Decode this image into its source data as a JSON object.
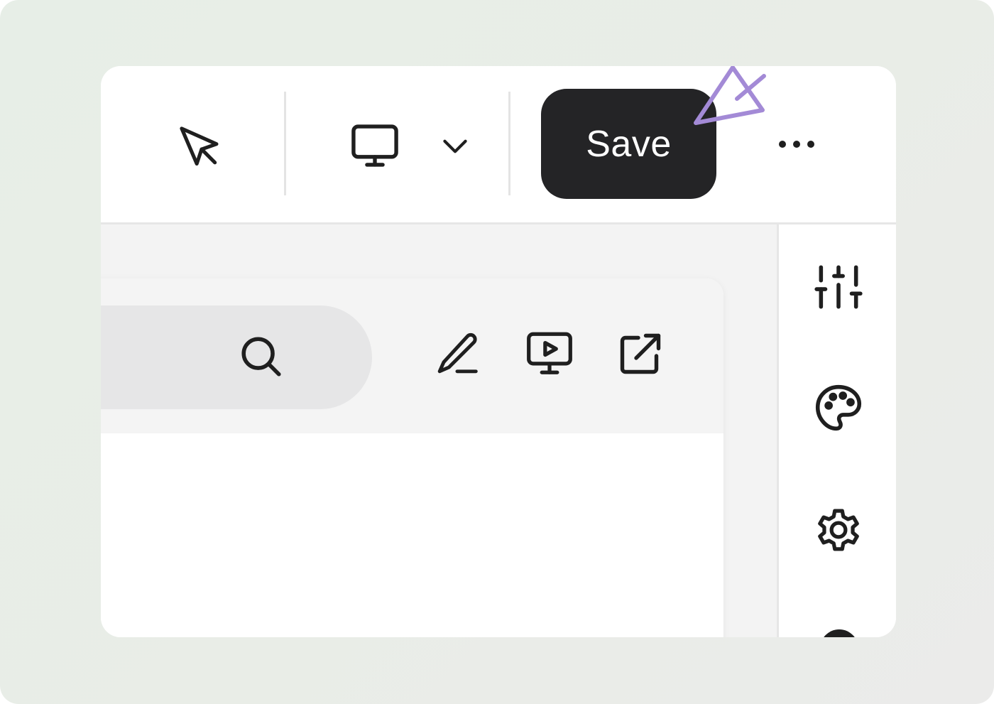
{
  "toolbar": {
    "select_tool_icon": "cursor-arrow-icon",
    "device_icon": "monitor-icon",
    "device_dropdown_icon": "chevron-down-icon",
    "save_label": "Save",
    "more_icon": "more-horizontal-icon",
    "annotation_icon": "pointer-arrow-icon"
  },
  "panel": {
    "search_icon": "search-icon",
    "actions": [
      {
        "icon": "pencil-icon"
      },
      {
        "icon": "monitor-play-icon"
      },
      {
        "icon": "external-link-icon"
      }
    ]
  },
  "sidebar": {
    "items": [
      {
        "icon": "sliders-icon"
      },
      {
        "icon": "palette-icon"
      },
      {
        "icon": "gear-icon"
      }
    ]
  },
  "colors": {
    "backdrop": "#e8ede7",
    "save_button": "#242426",
    "annotation_arrow": "#a38ad6"
  }
}
